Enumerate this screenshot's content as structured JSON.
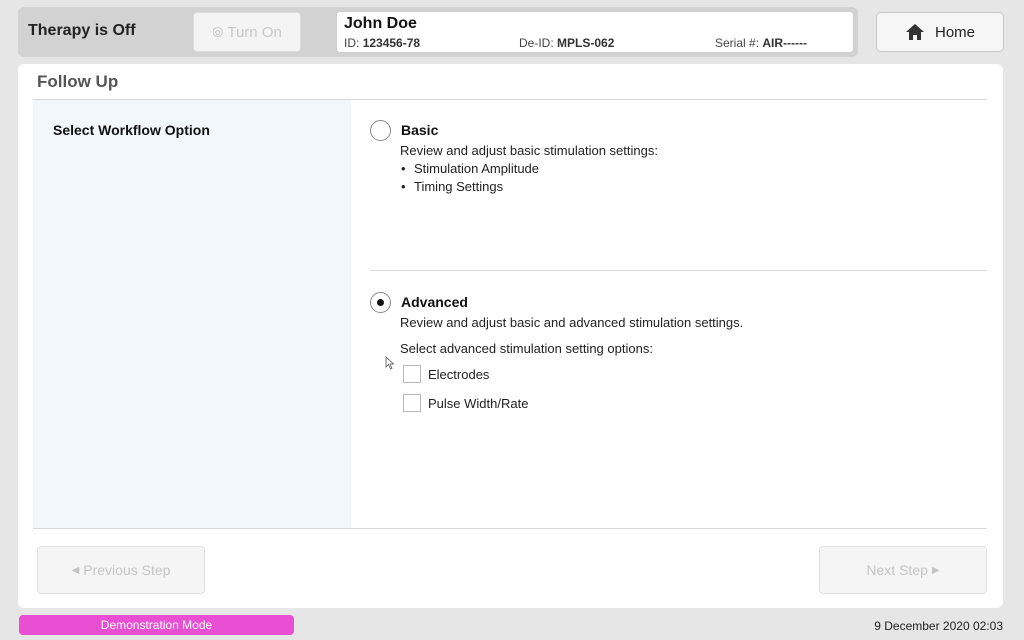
{
  "header": {
    "therapy_status": "Therapy is Off",
    "turn_on_label": "Turn On",
    "home_label": "Home"
  },
  "patient": {
    "name": "John Doe",
    "id_label": "ID:",
    "id_value": "123456-78",
    "deid_label": "De-ID:",
    "deid_value": "MPLS-062",
    "serial_label": "Serial #:",
    "serial_value": "AIR------"
  },
  "page": {
    "title": "Follow Up",
    "left_label": "Select Workflow Option"
  },
  "options": {
    "basic": {
      "title": "Basic",
      "description": "Review and adjust basic stimulation settings:",
      "bullets": [
        "Stimulation Amplitude",
        "Timing Settings"
      ],
      "selected": false
    },
    "advanced": {
      "title": "Advanced",
      "description": "Review and adjust basic and advanced stimulation settings.",
      "sub_label": "Select advanced stimulation setting options:",
      "checkboxes": [
        {
          "label": "Electrodes",
          "checked": false
        },
        {
          "label": "Pulse Width/Rate",
          "checked": false
        }
      ],
      "selected": true
    }
  },
  "nav": {
    "previous_label": "Previous Step",
    "next_label": "Next Step"
  },
  "footer": {
    "mode_label": "Demonstration Mode",
    "datetime": "9 December 2020 02:03"
  },
  "colors": {
    "demo_badge": "#e84fd3",
    "left_pane": "#f2f7fc",
    "disabled_text": "#c4c4c4"
  }
}
